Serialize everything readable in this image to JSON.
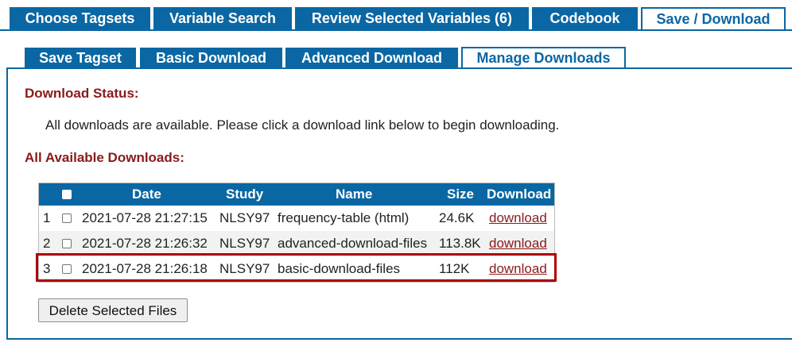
{
  "main_tabs": [
    {
      "label": "Choose Tagsets",
      "active": false
    },
    {
      "label": "Variable Search",
      "active": false
    },
    {
      "label": "Review Selected Variables (6)",
      "active": false
    },
    {
      "label": "Codebook",
      "active": false
    },
    {
      "label": "Save / Download",
      "active": true
    }
  ],
  "sub_tabs": [
    {
      "label": "Save Tagset",
      "active": false
    },
    {
      "label": "Basic Download",
      "active": false
    },
    {
      "label": "Advanced Download",
      "active": false
    },
    {
      "label": "Manage Downloads",
      "active": true
    }
  ],
  "status": {
    "heading": "Download Status:",
    "message": "All downloads are available. Please click a download link below to begin downloading."
  },
  "downloads": {
    "heading": "All Available Downloads:",
    "columns": {
      "date": "Date",
      "study": "Study",
      "name": "Name",
      "size": "Size",
      "download": "Download"
    },
    "rows": [
      {
        "num": "1",
        "date": "2021-07-28 21:27:15",
        "study": "NLSY97",
        "name": "frequency-table (html)",
        "size": "24.6K",
        "link": "download",
        "checked": false
      },
      {
        "num": "2",
        "date": "2021-07-28 21:26:32",
        "study": "NLSY97",
        "name": "advanced-download-files",
        "size": "113.8K",
        "link": "download",
        "checked": false
      },
      {
        "num": "3",
        "date": "2021-07-28 21:26:18",
        "study": "NLSY97",
        "name": "basic-download-files",
        "size": "112K",
        "link": "download",
        "checked": false,
        "highlighted": true
      }
    ]
  },
  "delete_button": "Delete Selected Files",
  "colors": {
    "tab_blue": "#0a67a3",
    "heading_red": "#8b1a1a",
    "highlight_red": "#b00000"
  }
}
